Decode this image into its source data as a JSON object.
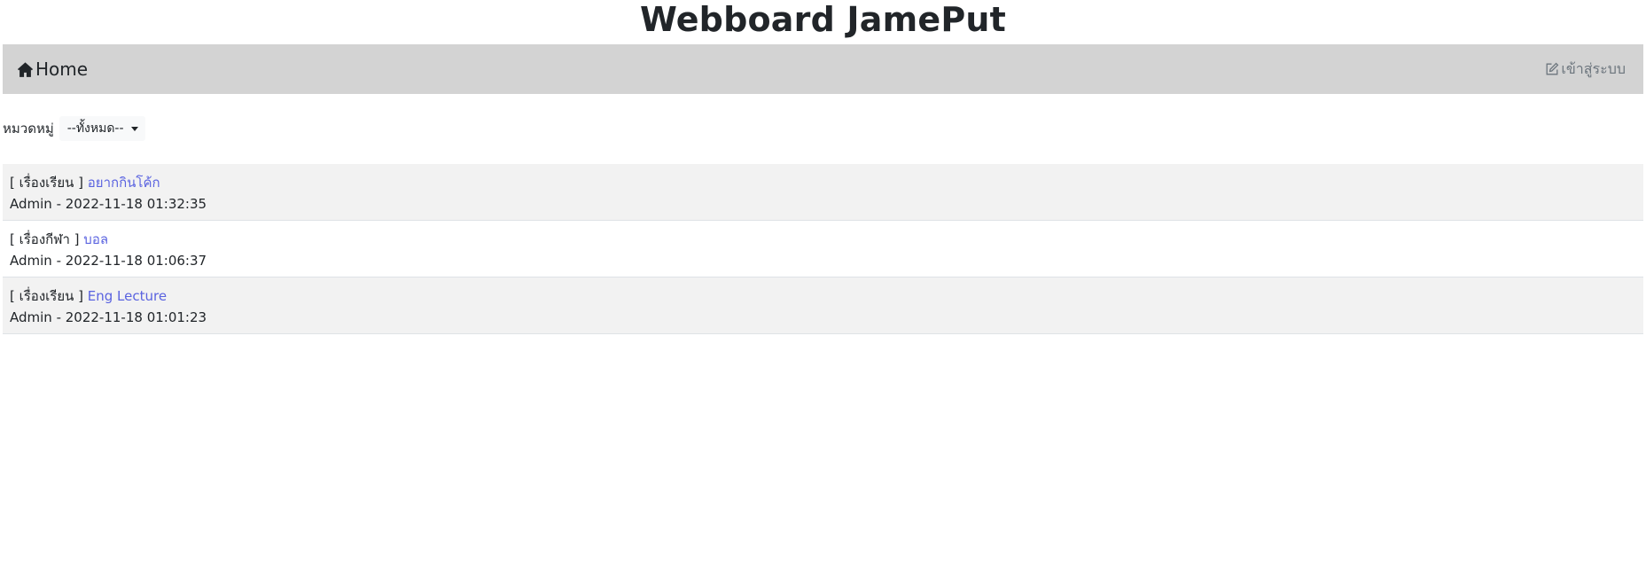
{
  "header": {
    "title": "Webboard JamePut"
  },
  "navbar": {
    "home_label": "Home",
    "login_label": "เข้าสู่ระบบ",
    "home_icon": "home-icon",
    "login_icon": "edit-icon",
    "background": "#d3d3d3"
  },
  "filter": {
    "label": "หมวดหมู่",
    "selected": "--ทั้งหมด--"
  },
  "topics": [
    {
      "category": "[ เรื่องเรียน ]",
      "title": "อยากกินโค้ก",
      "meta": "Admin - 2022-11-18 01:32:35"
    },
    {
      "category": "[ เรื่องกีฬา ]",
      "title": "บอล",
      "meta": "Admin - 2022-11-18 01:06:37"
    },
    {
      "category": "[ เรื่องเรียน ]",
      "title": "Eng Lecture",
      "meta": "Admin - 2022-11-18 01:01:23"
    }
  ],
  "colors": {
    "link": "#5a63e0",
    "row_alt": "#f2f2f2"
  }
}
